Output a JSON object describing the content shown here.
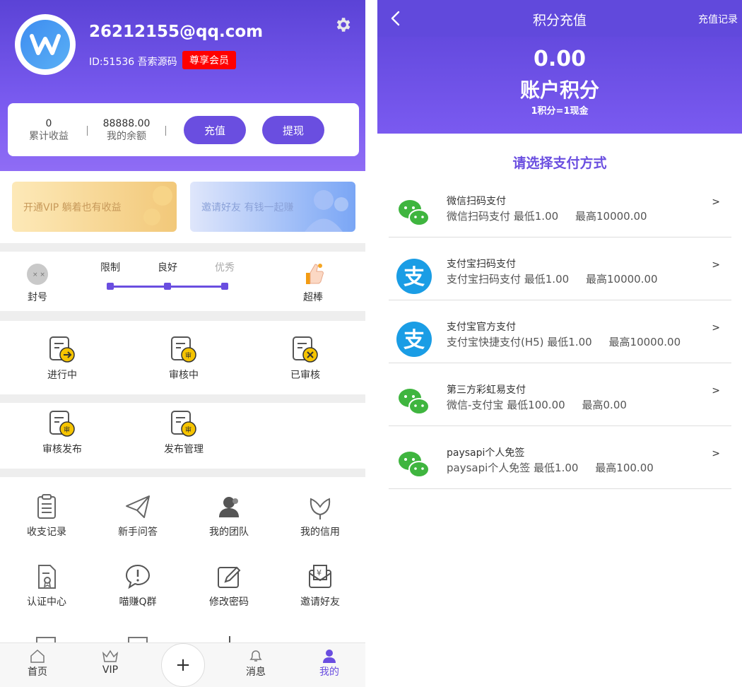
{
  "profile": {
    "username": "26212155@qq.com",
    "id_text": "ID:51536 吾索源码",
    "vip_badge": "尊享会员"
  },
  "balance": {
    "earnings_value": "0",
    "earnings_label": "累计收益",
    "balance_value": "88888.00",
    "balance_label": "我的余额",
    "recharge": "充值",
    "withdraw": "提现"
  },
  "banners": {
    "vip": "开通VIP 躺着也有收益",
    "invite": "邀请好友 有钱一起赚"
  },
  "rank": {
    "left": "封号",
    "levels": [
      "限制",
      "良好",
      "优秀"
    ],
    "right": "超棒"
  },
  "tasks": [
    "进行中",
    "审核中",
    "已审核"
  ],
  "publish": [
    "审核发布",
    "发布管理"
  ],
  "tools": [
    "收支记录",
    "新手问答",
    "我的团队",
    "我的信用",
    "认证中心",
    "喵赚Q群",
    "修改密码",
    "邀请好友"
  ],
  "tabbar": [
    "首页",
    "VIP",
    "+",
    "消息",
    "我的"
  ],
  "recharge_page": {
    "title": "积分充值",
    "history_link": "充值记录",
    "points_value": "0.00",
    "points_label": "账户积分",
    "rate": "1积分=1现金",
    "choose": "请选择支付方式",
    "arrow": ">",
    "methods": [
      {
        "name": "微信扫码支付",
        "desc": "微信扫码支付 最低1.00     最高10000.00",
        "icon": "wechat-icon"
      },
      {
        "name": "支付宝扫码支付",
        "desc": "支付宝扫码支付 最低1.00     最高10000.00",
        "icon": "alipay-icon"
      },
      {
        "name": "支付宝官方支付",
        "desc": "支付宝快捷支付(H5) 最低1.00     最高10000.00",
        "icon": "alipay-icon"
      },
      {
        "name": "第三方彩虹易支付",
        "desc": "微信-支付宝 最低100.00     最高0.00",
        "icon": "wechat-icon"
      },
      {
        "name": "paysapi个人免签",
        "desc": "paysapi个人免签 最低1.00     最高100.00",
        "icon": "wechat-icon"
      }
    ]
  },
  "colors": {
    "primary": "#6a4ee0",
    "badge_red": "#ff0000",
    "wechat_green": "#3fb53f",
    "alipay_blue": "#1a9de5"
  }
}
